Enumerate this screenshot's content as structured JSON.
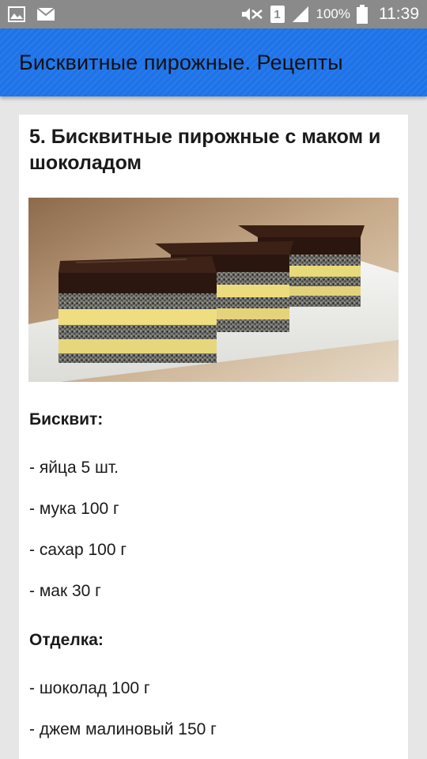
{
  "status_bar": {
    "battery_text": "100%",
    "time": "11:39",
    "sim_number": "1",
    "icons": [
      "gallery-icon",
      "mail-icon",
      "mute-icon",
      "sim-icon",
      "signal-icon",
      "battery-icon"
    ]
  },
  "app_bar": {
    "title": "Бисквитные пирожные. Рецепты",
    "color": "#1e73e8"
  },
  "recipe": {
    "title": "5. Бисквитные пирожные с маком и шоколадом",
    "photo": "poppy-seed-chocolate-cakes",
    "sections": [
      {
        "heading": "Бисквит:",
        "items": [
          "- яйца 5 шт.",
          "- мука 100 г",
          "- сахар 100 г",
          "- мак 30 г"
        ]
      },
      {
        "heading": "Отделка:",
        "items": [
          "- шоколад 100 г",
          "- джем малиновый 150 г"
        ]
      }
    ]
  }
}
